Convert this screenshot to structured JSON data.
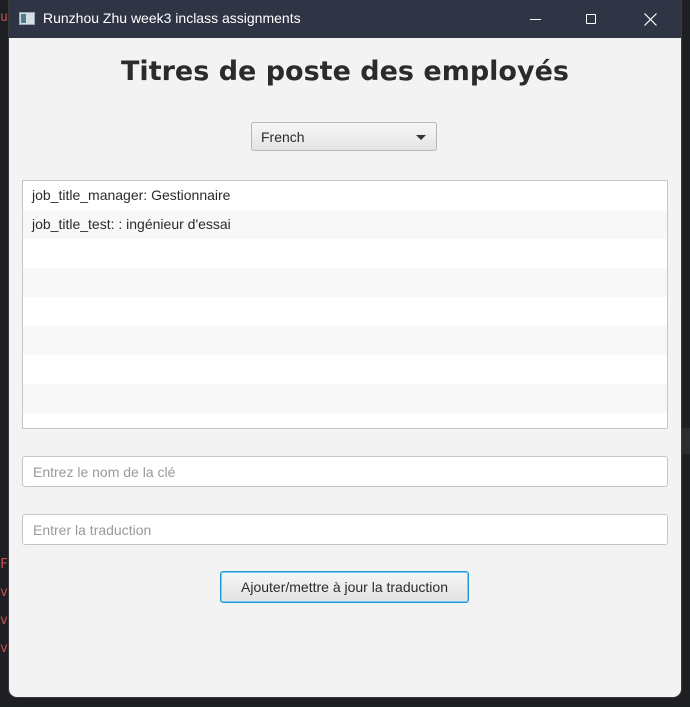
{
  "window": {
    "title": "Runzhou Zhu week3 inclass assignments"
  },
  "heading": "Titres de poste des employés",
  "language_select": {
    "selected": "French"
  },
  "translations": {
    "rows": [
      "job_title_manager: Gestionnaire",
      "job_title_test: : ingénieur d'essai",
      "",
      "",
      "",
      "",
      "",
      "",
      ""
    ]
  },
  "key_input": {
    "value": "",
    "placeholder": "Entrez le nom de la clé"
  },
  "translation_input": {
    "value": "",
    "placeholder": "Entrer la traduction"
  },
  "submit_button": {
    "label": "Ajouter/mettre à jour la traduction"
  },
  "background_fragments": [
    "u",
    "F",
    "v",
    "ve",
    "ve"
  ]
}
